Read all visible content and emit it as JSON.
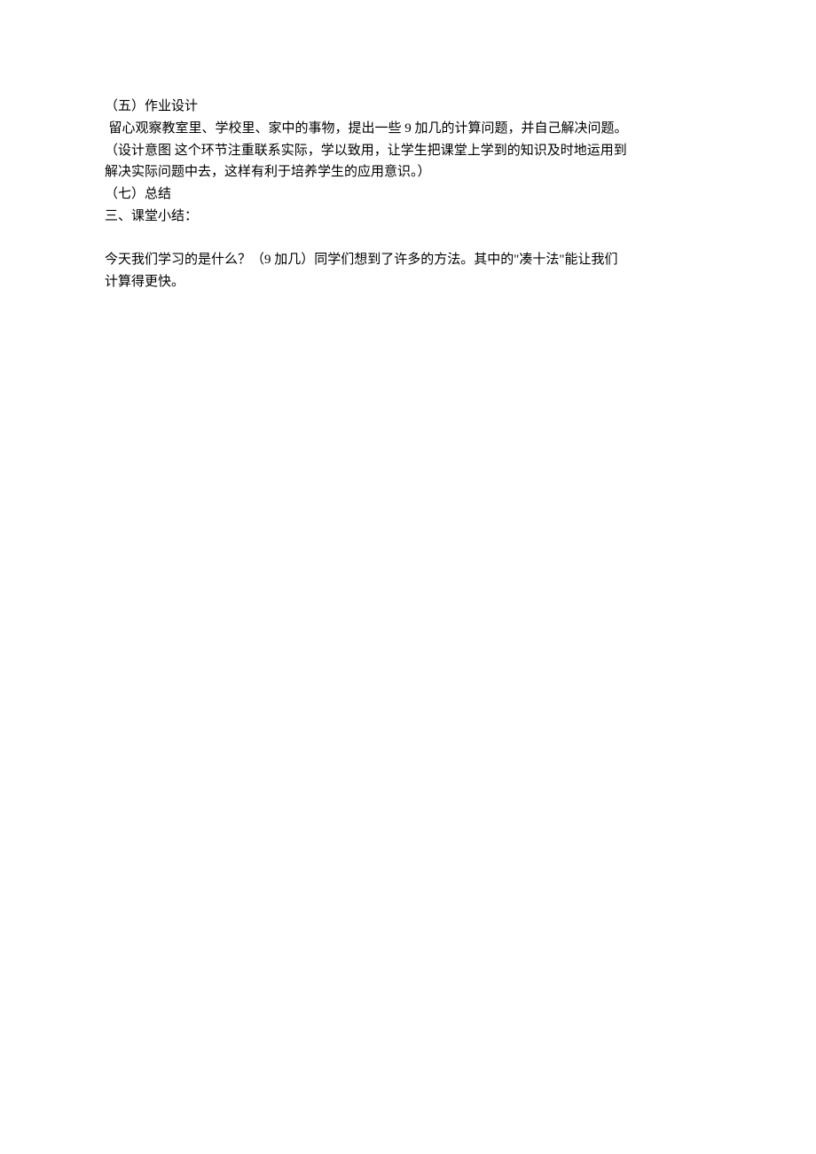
{
  "document": {
    "section5": {
      "heading": "（五）作业设计",
      "line1": " 留心观察教室里、学校里、家中的事物，提出一些 9 加几的计算问题，并自己解决问题。",
      "line2": "（设计意图 这个环节注重联系实际，学以致用，让学生把课堂上学到的知识及时地运用到",
      "line3": "解决实际问题中去，这样有利于培养学生的应用意识。）"
    },
    "section7": {
      "heading": "（七）总结"
    },
    "section_summary": {
      "heading": "三、课堂小结：",
      "line1": "今天我们学习的是什么？（9 加几）同学们想到了许多的方法。其中的\"凑十法\"能让我们",
      "line2": "计算得更快。"
    }
  }
}
